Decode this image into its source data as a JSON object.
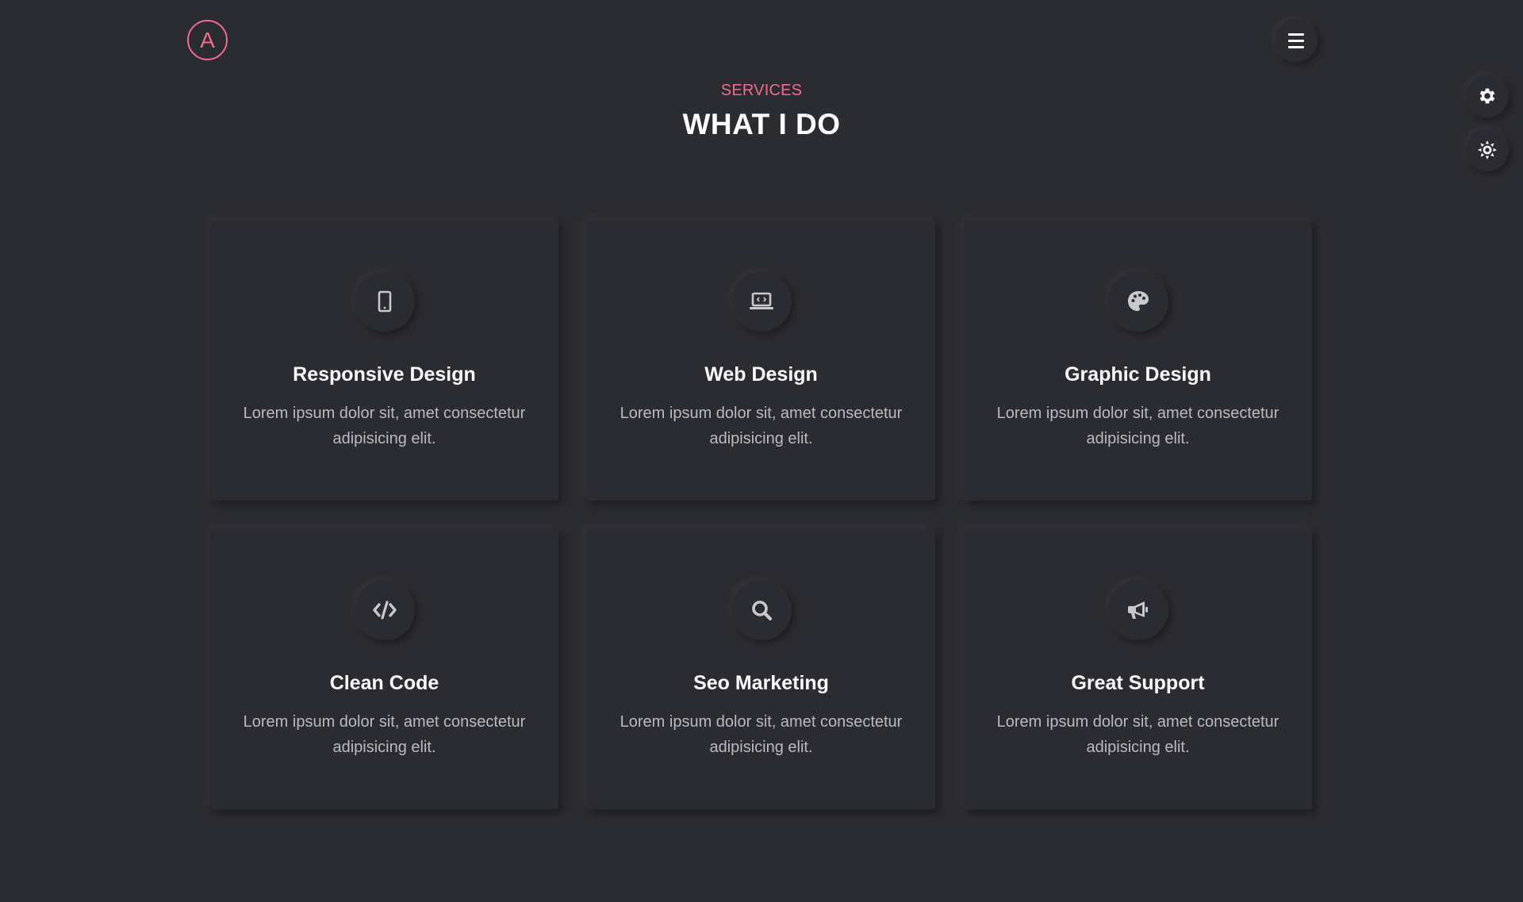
{
  "logo": {
    "letter": "A",
    "color": "#ef6d8e"
  },
  "header": {
    "menu_icon": "hamburger-menu-icon",
    "settings_icon": "gear-icon",
    "theme_icon": "sun-icon"
  },
  "section": {
    "eyebrow": "SERVICES",
    "title": "WHAT I DO"
  },
  "services": [
    {
      "title": "Responsive Design",
      "description": "Lorem ipsum dolor sit, amet consectetur adipisicing elit.",
      "icon": "mobile-phone-icon"
    },
    {
      "title": "Web Design",
      "description": "Lorem ipsum dolor sit, amet consectetur adipisicing elit.",
      "icon": "laptop-code-icon"
    },
    {
      "title": "Graphic Design",
      "description": "Lorem ipsum dolor sit, amet consectetur adipisicing elit.",
      "icon": "palette-icon"
    },
    {
      "title": "Clean Code",
      "description": "Lorem ipsum dolor sit, amet consectetur adipisicing elit.",
      "icon": "code-icon"
    },
    {
      "title": "Seo Marketing",
      "description": "Lorem ipsum dolor sit, amet consectetur adipisicing elit.",
      "icon": "search-icon"
    },
    {
      "title": "Great Support",
      "description": "Lorem ipsum dolor sit, amet consectetur adipisicing elit.",
      "icon": "megaphone-icon"
    }
  ],
  "colors": {
    "background": "#2b2c31",
    "accent": "#ef6d8e",
    "text": "#ffffff",
    "muted_text": "#b9bac0",
    "icon": "#c8c9ce"
  }
}
